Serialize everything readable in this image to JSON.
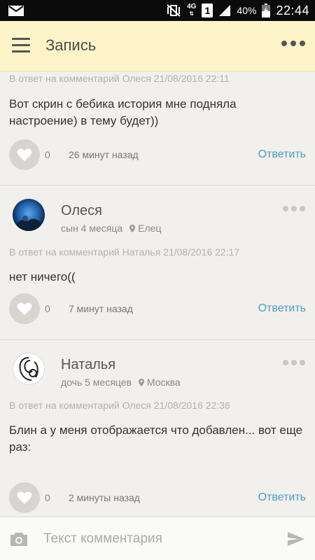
{
  "status_bar": {
    "network": "4G",
    "sim": "1",
    "battery": "40%",
    "time": "22:44"
  },
  "app_bar": {
    "title": "Запись"
  },
  "comments": [
    {
      "reply_to": "В ответ на комментарий Олеся  21/08/2016 22:11",
      "text": "Вот скрин с бебика история мне подняла настроение) в тему будет))",
      "likes": "0",
      "time_ago": "26 минут назад",
      "reply_label": "Ответить"
    },
    {
      "author": "Олеся",
      "child": "сын 4 месяца",
      "city": "Елец",
      "reply_to": "В ответ на комментарий Наталья  21/08/2016 22:17",
      "text": "нет ничего((",
      "likes": "0",
      "time_ago": "7 минут назад",
      "reply_label": "Ответить"
    },
    {
      "author": "Наталья",
      "child": "дочь 5 месяцев",
      "city": "Москва",
      "reply_to": "В ответ на комментарий Олеся  21/08/2016 22:36",
      "text": "Блин а у меня отображается что добавлен... вот еще раз:",
      "likes": "0",
      "time_ago": "2 минуты назад",
      "reply_label": "Ответить"
    }
  ],
  "input": {
    "placeholder": "Текст комментария",
    "value": ""
  },
  "colors": {
    "app_bar_bg": "#fdf5c9",
    "link": "#4d9cc6",
    "page_bg": "#f2f0ec"
  }
}
